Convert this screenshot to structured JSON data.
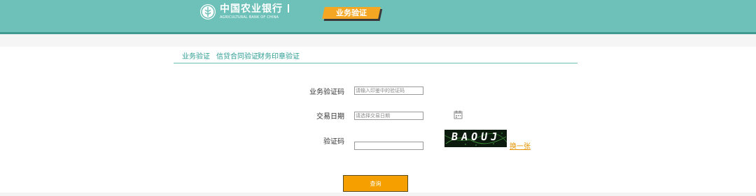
{
  "header": {
    "logo_cn": "中国农业银行",
    "logo_en": "AGRICULTURAL BANK OF CHINA",
    "title_tab": "业务验证"
  },
  "subnav": {
    "items": [
      {
        "label": "业务验证"
      },
      {
        "label": "信贷合同验证"
      },
      {
        "label": "财务印章验证"
      }
    ]
  },
  "form": {
    "code_label": "业务验证码",
    "code_placeholder": "请输入印鉴中的验证码",
    "date_label": "交易日期",
    "date_placeholder": "请选择交易日期",
    "captcha_label": "验证码",
    "captcha_value": "",
    "captcha_image_text": "BAOUJ",
    "change_link": "换一张",
    "submit_label": "查询"
  },
  "colors": {
    "header_bg": "#6ec1b8",
    "accent_orange": "#f5a623",
    "link_teal": "#2a9b91"
  }
}
